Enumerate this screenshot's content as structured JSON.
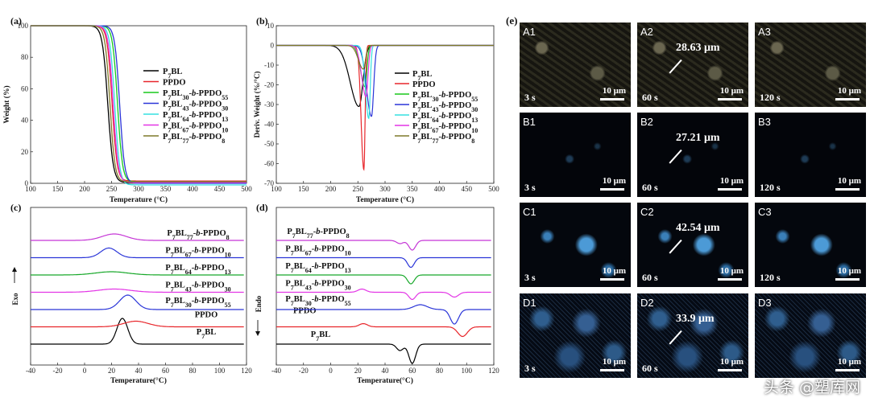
{
  "legend_labels": [
    "P7BL",
    "PPDO",
    "P7BL30-b-PPDO55",
    "P7BL43-b-PPDO30",
    "P7BL64-b-PPDO13",
    "P7BL67-b-PPDO10",
    "P7BL77-b-PPDO8"
  ],
  "chart_data": [
    {
      "panel": "(a)",
      "type": "line",
      "xlabel": "Temperature (°C)",
      "ylabel": "Weight (%)",
      "xlim": [
        100,
        500
      ],
      "ylim": [
        0,
        100
      ],
      "xticks": [
        100,
        150,
        200,
        250,
        300,
        350,
        400,
        450,
        500
      ],
      "yticks": [
        0,
        20,
        40,
        60,
        80,
        100
      ],
      "legend": "top-right",
      "series": [
        {
          "name": "P7BL",
          "color": "#000000",
          "t50": 243,
          "width": 11,
          "residue": 0.5
        },
        {
          "name": "PPDO",
          "color": "#e8262b",
          "t50": 251,
          "width": 10,
          "residue": 1.5
        },
        {
          "name": "P7BL30-b-PPDO55",
          "color": "#18c91b",
          "t50": 261,
          "width": 10,
          "residue": 1
        },
        {
          "name": "P7BL43-b-PPDO30",
          "color": "#2a35d8",
          "t50": 265,
          "width": 10,
          "residue": 0
        },
        {
          "name": "P7BL64-b-PPDO13",
          "color": "#35e0e0",
          "t50": 256,
          "width": 10,
          "residue": -1
        },
        {
          "name": "P7BL67-b-PPDO10",
          "color": "#e335e6",
          "t50": 253,
          "width": 10,
          "residue": 0.5
        },
        {
          "name": "P7BL77-b-PPDO8",
          "color": "#7f7a2a",
          "t50": 247,
          "width": 10,
          "residue": 1
        }
      ]
    },
    {
      "panel": "(b)",
      "type": "line",
      "xlabel": "Temperature (°C)",
      "ylabel": "Deriv. Weight (%/°C)",
      "xlim": [
        100,
        500
      ],
      "ylim": [
        -70,
        10
      ],
      "xticks": [
        100,
        150,
        200,
        250,
        300,
        350,
        400,
        450,
        500
      ],
      "yticks": [
        10,
        0,
        -10,
        -20,
        -30,
        -40,
        -50,
        -60,
        -70
      ],
      "legend": "top-right",
      "series": [
        {
          "name": "P7BL",
          "color": "#000000",
          "peak_x": 252,
          "peak_y": -31,
          "width": 16
        },
        {
          "name": "PPDO",
          "color": "#e8262b",
          "peak_x": 261,
          "peak_y": -63,
          "width": 5
        },
        {
          "name": "P7BL30-b-PPDO55",
          "color": "#18c91b",
          "peak_x": 263,
          "peak_y": -21,
          "width": 8
        },
        {
          "name": "P7BL43-b-PPDO30",
          "color": "#2a35d8",
          "peak_x": 275,
          "peak_y": -36,
          "width": 9
        },
        {
          "name": "P7BL64-b-PPDO13",
          "color": "#35e0e0",
          "peak_x": 270,
          "peak_y": -37,
          "width": 6
        },
        {
          "name": "P7BL67-b-PPDO10",
          "color": "#e335e6",
          "peak_x": 265,
          "peak_y": -26,
          "width": 8
        },
        {
          "name": "P7BL77-b-PPDO8",
          "color": "#7f7a2a",
          "peak_x": 260,
          "peak_y": -12,
          "width": 9
        }
      ]
    },
    {
      "panel": "(c)",
      "type": "line",
      "xlabel": "Temperature(°C)",
      "ylabel": "Exo",
      "xlim": [
        -40,
        120
      ],
      "xticks": [
        -40,
        -20,
        0,
        20,
        40,
        60,
        80,
        100,
        120
      ],
      "series": [
        {
          "name": "P7BL",
          "color": "#000000",
          "baseline": 0,
          "peaks": [
            {
              "x": 28,
              "h": 32,
              "w": 4
            }
          ]
        },
        {
          "name": "PPDO",
          "color": "#e8262b",
          "baseline": 1,
          "peaks": [
            {
              "x": 38,
              "h": 7,
              "w": 9
            }
          ]
        },
        {
          "name": "P7BL30-b-PPDO55",
          "color": "#2a35d8",
          "baseline": 2,
          "peaks": [
            {
              "x": 32,
              "h": 18,
              "w": 6
            }
          ]
        },
        {
          "name": "P7BL43-b-PPDO30",
          "color": "#e335e6",
          "baseline": 3,
          "peaks": [
            {
              "x": 22,
              "h": 4,
              "w": 12
            }
          ]
        },
        {
          "name": "P7BL64-b-PPDO13",
          "color": "#18a82a",
          "baseline": 4,
          "peaks": [
            {
              "x": 20,
              "h": 4,
              "w": 12
            }
          ]
        },
        {
          "name": "P7BL67-b-PPDO10",
          "color": "#2a35d8",
          "baseline": 5,
          "peaks": [
            {
              "x": 18,
              "h": 12,
              "w": 6
            }
          ]
        },
        {
          "name": "P7BL77-b-PPDO8",
          "color": "#c535d6",
          "baseline": 6,
          "peaks": [
            {
              "x": 22,
              "h": 8,
              "w": 9
            }
          ]
        }
      ]
    },
    {
      "panel": "(d)",
      "type": "line",
      "xlabel": "Temperature(°C)",
      "ylabel": "Endo",
      "xlim": [
        -40,
        120
      ],
      "xticks": [
        -40,
        -20,
        0,
        20,
        40,
        60,
        80,
        100,
        120
      ],
      "series": [
        {
          "name": "P7BL",
          "color": "#000000",
          "baseline": 0,
          "peaks": [
            {
              "x": 51,
              "h": -8,
              "w": 2.5
            },
            {
              "x": 60,
              "h": -24,
              "w": 2.5
            }
          ]
        },
        {
          "name": "PPDO",
          "color": "#e8262b",
          "baseline": 1,
          "peaks": [
            {
              "x": 24,
              "h": 4,
              "w": 3
            },
            {
              "x": 97,
              "h": -12,
              "w": 3.5
            }
          ]
        },
        {
          "name": "P7BL30-b-PPDO55",
          "color": "#2a35d8",
          "baseline": 2,
          "peaks": [
            {
              "x": 66,
              "h": 6,
              "w": 5
            },
            {
              "x": 91,
              "h": -18,
              "w": 3
            }
          ]
        },
        {
          "name": "P7BL43-b-PPDO30",
          "color": "#e335e6",
          "baseline": 3,
          "peaks": [
            {
              "x": 23,
              "h": 4,
              "w": 3
            },
            {
              "x": 60,
              "h": -9,
              "w": 2.5
            },
            {
              "x": 91,
              "h": -6,
              "w": 3
            }
          ]
        },
        {
          "name": "P7BL64-b-PPDO13",
          "color": "#18a82a",
          "baseline": 4,
          "peaks": [
            {
              "x": 59,
              "h": -11,
              "w": 2.5
            }
          ]
        },
        {
          "name": "P7BL67-b-PPDO10",
          "color": "#2a35d8",
          "baseline": 5,
          "peaks": [
            {
              "x": 59,
              "h": -12,
              "w": 2.5
            }
          ]
        },
        {
          "name": "P7BL77-b-PPDO8",
          "color": "#c535d6",
          "baseline": 6,
          "peaks": [
            {
              "x": 51,
              "h": -4,
              "w": 2.5
            },
            {
              "x": 60,
              "h": -12,
              "w": 2.5
            }
          ]
        }
      ]
    }
  ],
  "photos": {
    "panel": "(e)",
    "scale": "10 μm",
    "tiles": [
      {
        "id": "A1",
        "time": "3 s",
        "size": "",
        "style": "A"
      },
      {
        "id": "A2",
        "time": "60 s",
        "size": "28.63 μm",
        "style": "A"
      },
      {
        "id": "A3",
        "time": "120 s",
        "size": "",
        "style": "A"
      },
      {
        "id": "B1",
        "time": "3 s",
        "size": "",
        "style": "B"
      },
      {
        "id": "B2",
        "time": "60 s",
        "size": "27.21 μm",
        "style": "B"
      },
      {
        "id": "B3",
        "time": "120 s",
        "size": "",
        "style": "B"
      },
      {
        "id": "C1",
        "time": "3 s",
        "size": "",
        "style": "C"
      },
      {
        "id": "C2",
        "time": "60 s",
        "size": "42.54 μm",
        "style": "C"
      },
      {
        "id": "C3",
        "time": "120 s",
        "size": "",
        "style": "C"
      },
      {
        "id": "D1",
        "time": "3 s",
        "size": "",
        "style": "D"
      },
      {
        "id": "D2",
        "time": "60 s",
        "size": "33.9 μm",
        "style": "D"
      },
      {
        "id": "D3",
        "time": "",
        "size": "",
        "style": "D"
      }
    ]
  },
  "watermark": "头条 @塑库网"
}
